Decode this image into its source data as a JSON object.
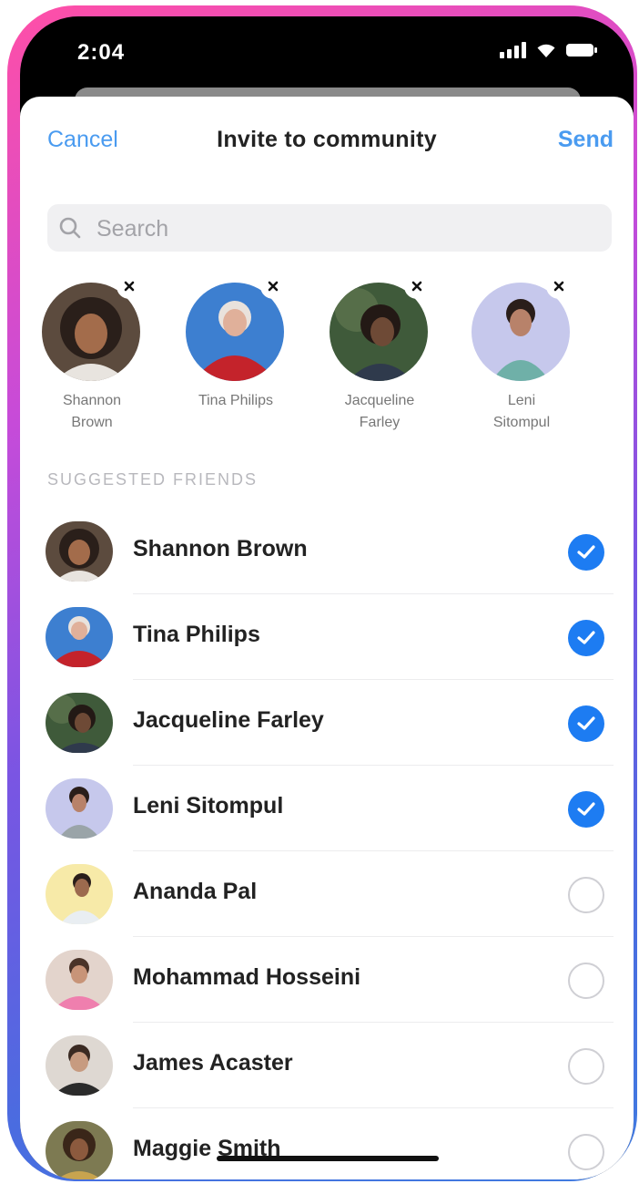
{
  "status_bar": {
    "time": "2:04"
  },
  "nav": {
    "cancel_label": "Cancel",
    "title": "Invite to community",
    "send_label": "Send"
  },
  "search": {
    "placeholder": "Search",
    "value": ""
  },
  "selected": [
    {
      "name_line1": "Shannon",
      "name_line2": "Brown",
      "avatar_icon": "shannon-brown-avatar"
    },
    {
      "name_line1": "Tina Philips",
      "name_line2": "",
      "avatar_icon": "tina-philips-avatar"
    },
    {
      "name_line1": "Jacqueline",
      "name_line2": "Farley",
      "avatar_icon": "jacqueline-farley-avatar"
    },
    {
      "name_line1": "Leni",
      "name_line2": "Sitompul",
      "avatar_icon": "leni-sitompul-avatar"
    }
  ],
  "suggested_label": "SUGGESTED FRIENDS",
  "friends": [
    {
      "name": "Shannon Brown",
      "selected": true
    },
    {
      "name": "Tina Philips",
      "selected": true
    },
    {
      "name": "Jacqueline Farley",
      "selected": true
    },
    {
      "name": "Leni Sitompul",
      "selected": true
    },
    {
      "name": "Ananda Pal",
      "selected": false
    },
    {
      "name": "Mohammad Hosseini",
      "selected": false
    },
    {
      "name": "James Acaster",
      "selected": false
    },
    {
      "name": "Maggie Smith",
      "selected": false
    }
  ],
  "colors": {
    "accent": "#4a9bf0",
    "check_fill": "#1d7cf2",
    "frame_gradient_top": "#ff4fa7",
    "frame_gradient_bottom": "#3f7be0"
  }
}
